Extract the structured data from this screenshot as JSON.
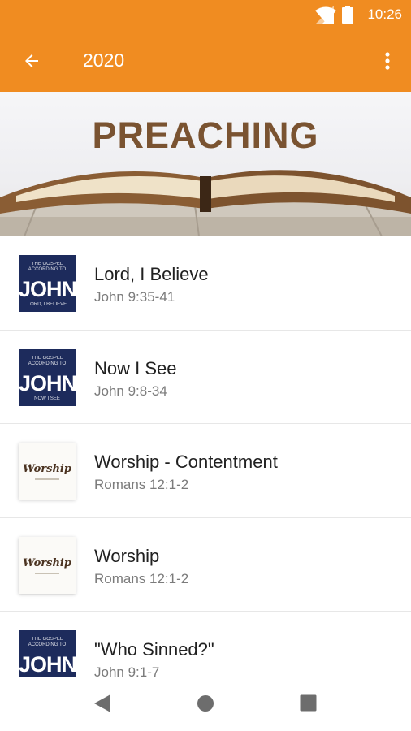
{
  "status_bar": {
    "time": "10:26"
  },
  "app_bar": {
    "title": "2020",
    "back_icon": "arrow-back-icon",
    "menu_icon": "more-vert-icon"
  },
  "banner": {
    "title": "PREACHING"
  },
  "sermons": [
    {
      "title": "Lord, I Believe",
      "subtitle": "John 9:35-41",
      "thumb": {
        "type": "john",
        "top": "THE GOSPEL ACCORDING TO",
        "big": "JOHN",
        "bottom": "LORD, I BELIEVE"
      }
    },
    {
      "title": "Now I See",
      "subtitle": "John 9:8-34",
      "thumb": {
        "type": "john",
        "top": "THE GOSPEL ACCORDING TO",
        "big": "JOHN",
        "bottom": "NOW I SEE"
      }
    },
    {
      "title": "Worship - Contentment",
      "subtitle": "Romans 12:1-2",
      "thumb": {
        "type": "worship",
        "script": "Worship"
      }
    },
    {
      "title": "Worship",
      "subtitle": "Romans 12:1-2",
      "thumb": {
        "type": "worship",
        "script": "Worship"
      }
    },
    {
      "title": "\"Who Sinned?\"",
      "subtitle": "John 9:1-7",
      "thumb": {
        "type": "john",
        "top": "THE GOSPEL ACCORDING TO",
        "big": "JOHN",
        "bottom": ""
      }
    }
  ],
  "colors": {
    "app_bar": "#f08c21",
    "banner_title": "#7a5331",
    "thumb_john_bg": "#1d2b5c"
  }
}
